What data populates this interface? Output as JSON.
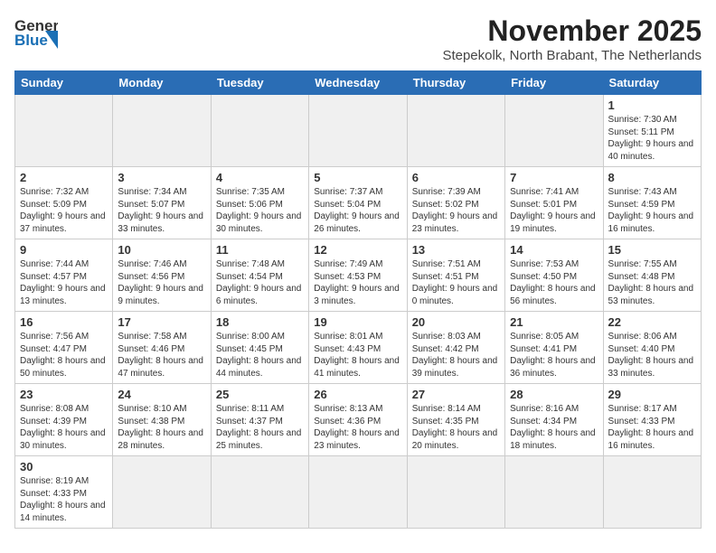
{
  "header": {
    "logo_line1": "General",
    "logo_line2": "Blue",
    "month_title": "November 2025",
    "location": "Stepekolk, North Brabant, The Netherlands"
  },
  "weekdays": [
    "Sunday",
    "Monday",
    "Tuesday",
    "Wednesday",
    "Thursday",
    "Friday",
    "Saturday"
  ],
  "weeks": [
    [
      {
        "day": "",
        "info": ""
      },
      {
        "day": "",
        "info": ""
      },
      {
        "day": "",
        "info": ""
      },
      {
        "day": "",
        "info": ""
      },
      {
        "day": "",
        "info": ""
      },
      {
        "day": "",
        "info": ""
      },
      {
        "day": "1",
        "info": "Sunrise: 7:30 AM\nSunset: 5:11 PM\nDaylight: 9 hours and 40 minutes."
      }
    ],
    [
      {
        "day": "2",
        "info": "Sunrise: 7:32 AM\nSunset: 5:09 PM\nDaylight: 9 hours and 37 minutes."
      },
      {
        "day": "3",
        "info": "Sunrise: 7:34 AM\nSunset: 5:07 PM\nDaylight: 9 hours and 33 minutes."
      },
      {
        "day": "4",
        "info": "Sunrise: 7:35 AM\nSunset: 5:06 PM\nDaylight: 9 hours and 30 minutes."
      },
      {
        "day": "5",
        "info": "Sunrise: 7:37 AM\nSunset: 5:04 PM\nDaylight: 9 hours and 26 minutes."
      },
      {
        "day": "6",
        "info": "Sunrise: 7:39 AM\nSunset: 5:02 PM\nDaylight: 9 hours and 23 minutes."
      },
      {
        "day": "7",
        "info": "Sunrise: 7:41 AM\nSunset: 5:01 PM\nDaylight: 9 hours and 19 minutes."
      },
      {
        "day": "8",
        "info": "Sunrise: 7:43 AM\nSunset: 4:59 PM\nDaylight: 9 hours and 16 minutes."
      }
    ],
    [
      {
        "day": "9",
        "info": "Sunrise: 7:44 AM\nSunset: 4:57 PM\nDaylight: 9 hours and 13 minutes."
      },
      {
        "day": "10",
        "info": "Sunrise: 7:46 AM\nSunset: 4:56 PM\nDaylight: 9 hours and 9 minutes."
      },
      {
        "day": "11",
        "info": "Sunrise: 7:48 AM\nSunset: 4:54 PM\nDaylight: 9 hours and 6 minutes."
      },
      {
        "day": "12",
        "info": "Sunrise: 7:49 AM\nSunset: 4:53 PM\nDaylight: 9 hours and 3 minutes."
      },
      {
        "day": "13",
        "info": "Sunrise: 7:51 AM\nSunset: 4:51 PM\nDaylight: 9 hours and 0 minutes."
      },
      {
        "day": "14",
        "info": "Sunrise: 7:53 AM\nSunset: 4:50 PM\nDaylight: 8 hours and 56 minutes."
      },
      {
        "day": "15",
        "info": "Sunrise: 7:55 AM\nSunset: 4:48 PM\nDaylight: 8 hours and 53 minutes."
      }
    ],
    [
      {
        "day": "16",
        "info": "Sunrise: 7:56 AM\nSunset: 4:47 PM\nDaylight: 8 hours and 50 minutes."
      },
      {
        "day": "17",
        "info": "Sunrise: 7:58 AM\nSunset: 4:46 PM\nDaylight: 8 hours and 47 minutes."
      },
      {
        "day": "18",
        "info": "Sunrise: 8:00 AM\nSunset: 4:45 PM\nDaylight: 8 hours and 44 minutes."
      },
      {
        "day": "19",
        "info": "Sunrise: 8:01 AM\nSunset: 4:43 PM\nDaylight: 8 hours and 41 minutes."
      },
      {
        "day": "20",
        "info": "Sunrise: 8:03 AM\nSunset: 4:42 PM\nDaylight: 8 hours and 39 minutes."
      },
      {
        "day": "21",
        "info": "Sunrise: 8:05 AM\nSunset: 4:41 PM\nDaylight: 8 hours and 36 minutes."
      },
      {
        "day": "22",
        "info": "Sunrise: 8:06 AM\nSunset: 4:40 PM\nDaylight: 8 hours and 33 minutes."
      }
    ],
    [
      {
        "day": "23",
        "info": "Sunrise: 8:08 AM\nSunset: 4:39 PM\nDaylight: 8 hours and 30 minutes."
      },
      {
        "day": "24",
        "info": "Sunrise: 8:10 AM\nSunset: 4:38 PM\nDaylight: 8 hours and 28 minutes."
      },
      {
        "day": "25",
        "info": "Sunrise: 8:11 AM\nSunset: 4:37 PM\nDaylight: 8 hours and 25 minutes."
      },
      {
        "day": "26",
        "info": "Sunrise: 8:13 AM\nSunset: 4:36 PM\nDaylight: 8 hours and 23 minutes."
      },
      {
        "day": "27",
        "info": "Sunrise: 8:14 AM\nSunset: 4:35 PM\nDaylight: 8 hours and 20 minutes."
      },
      {
        "day": "28",
        "info": "Sunrise: 8:16 AM\nSunset: 4:34 PM\nDaylight: 8 hours and 18 minutes."
      },
      {
        "day": "29",
        "info": "Sunrise: 8:17 AM\nSunset: 4:33 PM\nDaylight: 8 hours and 16 minutes."
      }
    ],
    [
      {
        "day": "30",
        "info": "Sunrise: 8:19 AM\nSunset: 4:33 PM\nDaylight: 8 hours and 14 minutes."
      },
      {
        "day": "",
        "info": ""
      },
      {
        "day": "",
        "info": ""
      },
      {
        "day": "",
        "info": ""
      },
      {
        "day": "",
        "info": ""
      },
      {
        "day": "",
        "info": ""
      },
      {
        "day": "",
        "info": ""
      }
    ]
  ]
}
